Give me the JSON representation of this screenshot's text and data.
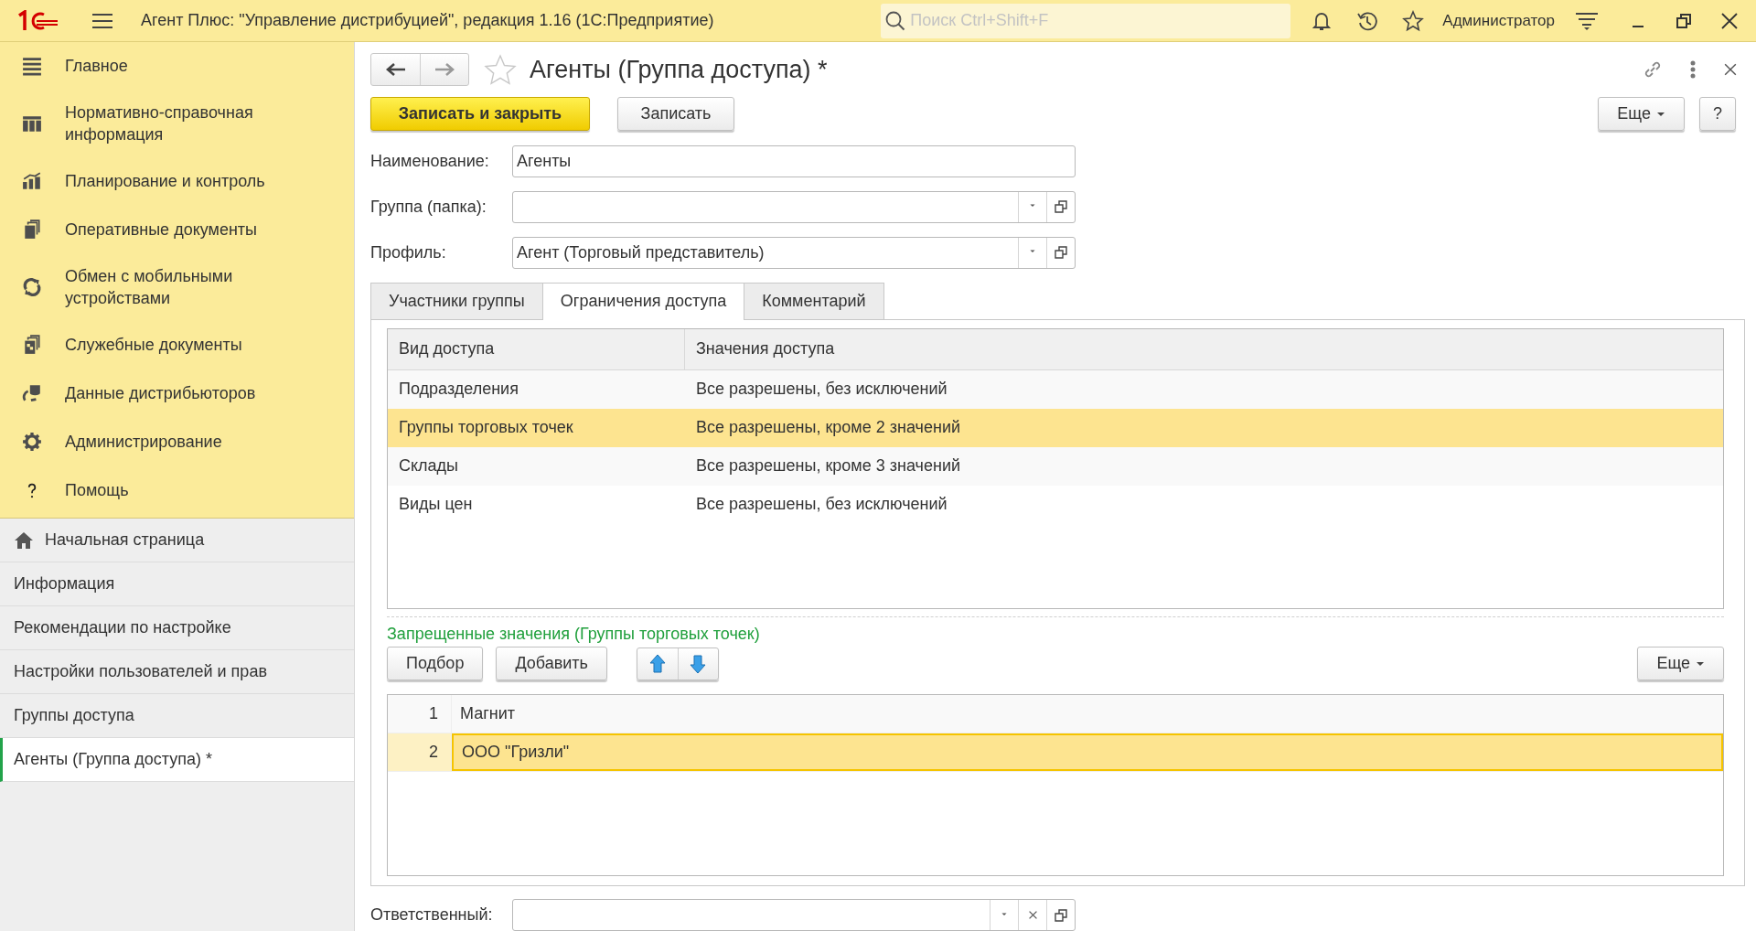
{
  "window": {
    "title": "Агент Плюс: \"Управление дистрибуцией\", редакция 1.16  (1С:Предприятие)"
  },
  "search": {
    "placeholder": "Поиск Ctrl+Shift+F"
  },
  "user": "Администратор",
  "sections": [
    {
      "label": "Главное"
    },
    {
      "label": "Нормативно-справочная информация"
    },
    {
      "label": "Планирование и контроль"
    },
    {
      "label": "Оперативные документы"
    },
    {
      "label": "Обмен с мобильными устройствами"
    },
    {
      "label": "Служебные документы"
    },
    {
      "label": "Данные дистрибьюторов"
    },
    {
      "label": "Администрирование"
    },
    {
      "label": "Помощь"
    }
  ],
  "open_windows": [
    {
      "label": "Начальная страница",
      "selected": false
    },
    {
      "label": "Информация",
      "selected": false
    },
    {
      "label": "Рекомендации по настройке",
      "selected": false
    },
    {
      "label": "Настройки пользователей и прав",
      "selected": false
    },
    {
      "label": "Группы доступа",
      "selected": false
    },
    {
      "label": "Агенты (Группа доступа) *",
      "selected": true
    }
  ],
  "form": {
    "title": "Агенты (Группа доступа) *",
    "favorite": false,
    "buttons": [
      {
        "label": "Записать и закрыть",
        "kind": "default"
      },
      {
        "label": "Записать",
        "kind": "plain"
      }
    ],
    "more": "Еще",
    "help": "?",
    "fields": [
      {
        "label": "Наименование:",
        "value": "Агенты",
        "kind": "text"
      },
      {
        "label": "Группа (папка):",
        "kind": "choice"
      },
      {
        "label": "Профиль:",
        "value": "Агент (Торговый представитель)",
        "kind": "choice"
      }
    ],
    "tabs": [
      {
        "label": "Участники группы",
        "selected": false
      },
      {
        "label": "Ограничения доступа",
        "selected": true
      },
      {
        "label": "Комментарий",
        "selected": false
      }
    ],
    "access_table": {
      "columns": [
        "Вид доступа",
        "Значения доступа"
      ],
      "rows": [
        {
          "cells": [
            "Подразделения",
            "Все разрешены, без исключений"
          ],
          "selected": false
        },
        {
          "cells": [
            "Группы торговых точек",
            "Все разрешены, кроме 2 значений"
          ],
          "selected": true
        },
        {
          "cells": [
            "Склады",
            "Все разрешены, кроме 3 значений"
          ],
          "selected": false
        },
        {
          "cells": [
            "Виды цен",
            "Все разрешены, без исключений"
          ],
          "selected": false
        }
      ]
    },
    "values": {
      "title": "Запрещенные значения (Группы торговых точек)",
      "buttons": [
        "Подбор",
        "Добавить"
      ],
      "more": "Еще",
      "rows": [
        {
          "number": "1",
          "value": "Магнит",
          "selected": false
        },
        {
          "number": "2",
          "value": "ООО \"Гризли\"",
          "selected": true
        }
      ]
    },
    "responsible": {
      "label": "Ответственный:"
    }
  }
}
